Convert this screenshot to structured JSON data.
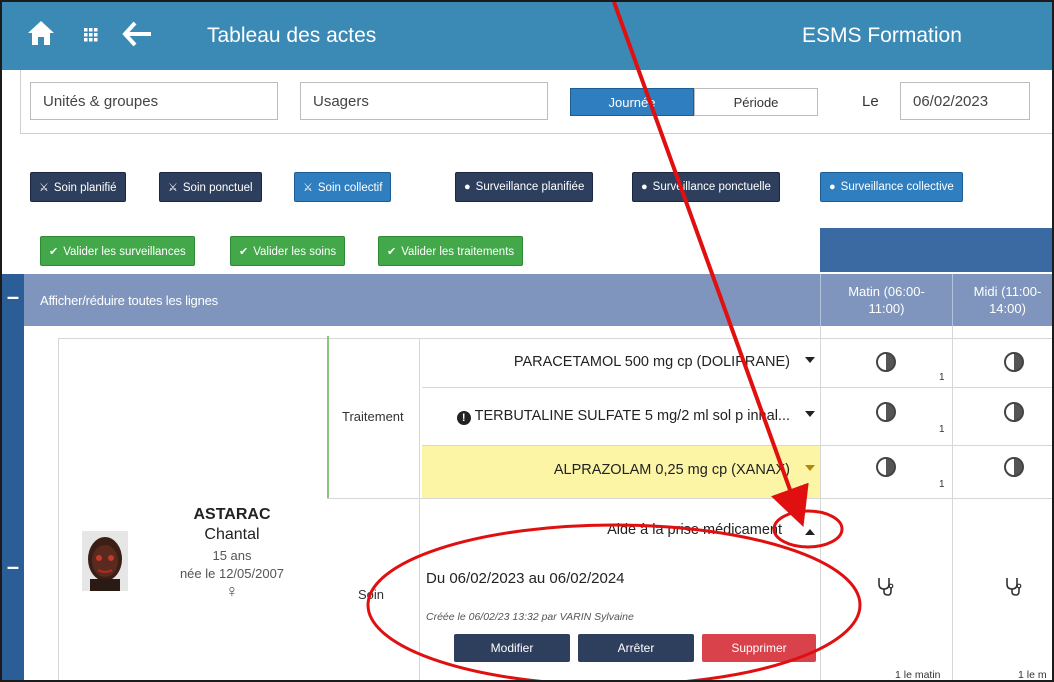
{
  "header": {
    "title": "Tableau des actes",
    "organization": "ESMS Formation",
    "icons": [
      "home-icon",
      "apps-grid-icon",
      "back-arrow-icon"
    ]
  },
  "filters": {
    "units_placeholder": "Unités & groupes",
    "users_placeholder": "Usagers",
    "mode_day": "Journée",
    "mode_period": "Période",
    "selected_mode": "Journée",
    "date_label": "Le",
    "date_value": "06/02/2023"
  },
  "type_buttons": {
    "soin_planifie": "Soin planifié",
    "soin_ponctuel": "Soin ponctuel",
    "soin_collectif": "Soin collectif",
    "surv_planifiee": "Surveillance planifiée",
    "surv_ponctuelle": "Surveillance ponctuelle",
    "surv_collective": "Surveillance collective"
  },
  "validate_buttons": {
    "surveillances": "Valider les surveillances",
    "soins": "Valider les soins",
    "traitements": "Valider les traitements"
  },
  "table_header": {
    "toggle_label": "Afficher/réduire toutes les lignes",
    "col_matin_l1": "Matin (06:00-",
    "col_matin_l2": "11:00)",
    "col_midi_l1": "Midi (11:00-",
    "col_midi_l2": "14:00)"
  },
  "patient": {
    "last_name": "ASTARAC",
    "first_name": "Chantal",
    "age": "15 ans",
    "birth": "née le 12/05/2007",
    "sex_symbol": "♀"
  },
  "categories": {
    "traitement": "Traitement",
    "soin": "Soin"
  },
  "treatments": [
    {
      "name": "PARACETAMOL 500 mg cp (DOLIPRANE)",
      "count": "1"
    },
    {
      "name": "TERBUTALINE SULFATE 5 mg/2 ml sol p inhal...",
      "count": "1"
    },
    {
      "name": "ALPRAZOLAM 0,25 mg cp (XANAX)",
      "count": "1"
    }
  ],
  "soin": {
    "name": "Aide à la prise médicament",
    "period": "Du 06/02/2023 au 06/02/2024",
    "created": "Créée le 06/02/23 13:32 par VARIN Sylvaine",
    "btn_modify": "Modifier",
    "btn_stop": "Arrêter",
    "btn_delete": "Supprimer",
    "freq_matin": "1 le matin",
    "freq_midi": "1 le m"
  },
  "colors": {
    "topbar": "#3b8ab6",
    "header_row": "#7f95bd",
    "dark_button": "#2e3f5d",
    "blue_button": "#2f7fc0",
    "green_button": "#43a84a",
    "danger": "#d9424a",
    "highlight_row": "#fbf5a5",
    "annotation": "#e01010"
  }
}
